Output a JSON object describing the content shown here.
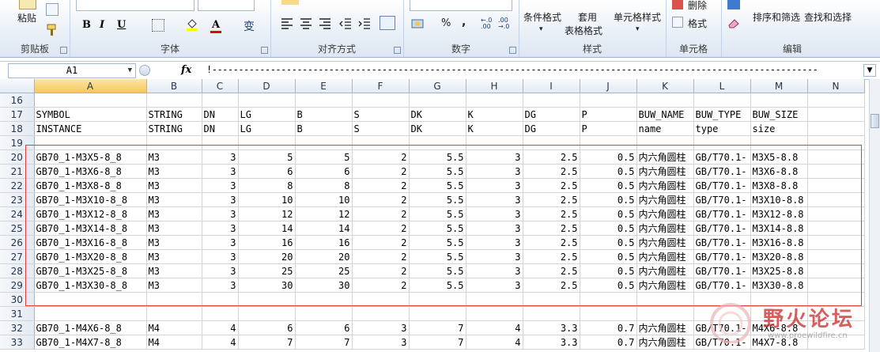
{
  "ribbon": {
    "clipboard": {
      "label": "剪贴板",
      "paste": "粘贴"
    },
    "font": {
      "label": "字体",
      "bold": "B",
      "italic": "I",
      "underline": "U",
      "font_color_glyph": "A",
      "phonetic_glyph": "变"
    },
    "alignment": {
      "label": "对齐方式"
    },
    "number": {
      "label": "数字",
      "percent": "%",
      "comma": ","
    },
    "styles": {
      "label": "样式",
      "conditional": "条件格式",
      "table_line1": "套用",
      "table_line2": "表格格式",
      "cell_styles": "单元格样式"
    },
    "cells": {
      "label": "单元格",
      "delete": "删除",
      "format": "格式"
    },
    "editing": {
      "label": "编辑",
      "sort_filter": "排序和筛选",
      "find_select": "查找和选择"
    }
  },
  "formula_bar": {
    "name_box": "A1",
    "fx": "fx",
    "content": "!------------------------------------------------------------------------------------------------------------------"
  },
  "columns": [
    "A",
    "B",
    "C",
    "D",
    "E",
    "F",
    "G",
    "H",
    "I",
    "J",
    "K",
    "L",
    "M",
    "N"
  ],
  "rows": [
    {
      "n": "16",
      "cells": [
        "",
        "",
        "",
        "",
        "",
        "",
        "",
        "",
        "",
        "",
        "",
        "",
        "",
        ""
      ]
    },
    {
      "n": "17",
      "cells": [
        "SYMBOL",
        "STRING",
        "DN",
        "LG",
        "B",
        "S",
        "DK",
        "K",
        "DG",
        "P",
        "BUW_NAME",
        "BUW_TYPE",
        "BUW_SIZE",
        ""
      ]
    },
    {
      "n": "18",
      "cells": [
        "INSTANCE",
        "STRING",
        "DN",
        "LG",
        "B",
        "S",
        "DK",
        "K",
        "DG",
        "P",
        "name",
        "type",
        "size",
        ""
      ]
    },
    {
      "n": "19",
      "cells": [
        "",
        "",
        "",
        "",
        "",
        "",
        "",
        "",
        "",
        "",
        "",
        "",
        "",
        ""
      ]
    },
    {
      "n": "20",
      "cells": [
        "GB70_1-M3X5-8_8",
        "M3",
        "3",
        "5",
        "5",
        "2",
        "5.5",
        "3",
        "2.5",
        "0.5",
        "内六角圆柱",
        "GB/T70.1-",
        "M3X5-8.8",
        ""
      ]
    },
    {
      "n": "21",
      "cells": [
        "GB70_1-M3X6-8_8",
        "M3",
        "3",
        "6",
        "6",
        "2",
        "5.5",
        "3",
        "2.5",
        "0.5",
        "内六角圆柱",
        "GB/T70.1-",
        "M3X6-8.8",
        ""
      ]
    },
    {
      "n": "22",
      "cells": [
        "GB70_1-M3X8-8_8",
        "M3",
        "3",
        "8",
        "8",
        "2",
        "5.5",
        "3",
        "2.5",
        "0.5",
        "内六角圆柱",
        "GB/T70.1-",
        "M3X8-8.8",
        ""
      ]
    },
    {
      "n": "23",
      "cells": [
        "GB70_1-M3X10-8_8",
        "M3",
        "3",
        "10",
        "10",
        "2",
        "5.5",
        "3",
        "2.5",
        "0.5",
        "内六角圆柱",
        "GB/T70.1-",
        "M3X10-8.8",
        ""
      ]
    },
    {
      "n": "24",
      "cells": [
        "GB70_1-M3X12-8_8",
        "M3",
        "3",
        "12",
        "12",
        "2",
        "5.5",
        "3",
        "2.5",
        "0.5",
        "内六角圆柱",
        "GB/T70.1-",
        "M3X12-8.8",
        ""
      ]
    },
    {
      "n": "25",
      "cells": [
        "GB70_1-M3X14-8_8",
        "M3",
        "3",
        "14",
        "14",
        "2",
        "5.5",
        "3",
        "2.5",
        "0.5",
        "内六角圆柱",
        "GB/T70.1-",
        "M3X14-8.8",
        ""
      ]
    },
    {
      "n": "26",
      "cells": [
        "GB70_1-M3X16-8_8",
        "M3",
        "3",
        "16",
        "16",
        "2",
        "5.5",
        "3",
        "2.5",
        "0.5",
        "内六角圆柱",
        "GB/T70.1-",
        "M3X16-8.8",
        ""
      ]
    },
    {
      "n": "27",
      "cells": [
        "GB70_1-M3X20-8_8",
        "M3",
        "3",
        "20",
        "20",
        "2",
        "5.5",
        "3",
        "2.5",
        "0.5",
        "内六角圆柱",
        "GB/T70.1-",
        "M3X20-8.8",
        ""
      ]
    },
    {
      "n": "28",
      "cells": [
        "GB70_1-M3X25-8_8",
        "M3",
        "3",
        "25",
        "25",
        "2",
        "5.5",
        "3",
        "2.5",
        "0.5",
        "内六角圆柱",
        "GB/T70.1-",
        "M3X25-8.8",
        ""
      ]
    },
    {
      "n": "29",
      "cells": [
        "GB70_1-M3X30-8_8",
        "M3",
        "3",
        "30",
        "30",
        "2",
        "5.5",
        "3",
        "2.5",
        "0.5",
        "内六角圆柱",
        "GB/T70.1-",
        "M3X30-8.8",
        ""
      ]
    },
    {
      "n": "30",
      "cells": [
        "",
        "",
        "",
        "",
        "",
        "",
        "",
        "",
        "",
        "",
        "",
        "",
        "",
        ""
      ]
    },
    {
      "n": "31",
      "cells": [
        "",
        "",
        "",
        "",
        "",
        "",
        "",
        "",
        "",
        "",
        "",
        "",
        "",
        ""
      ]
    },
    {
      "n": "32",
      "cells": [
        "GB70_1-M4X6-8_8",
        "M4",
        "4",
        "6",
        "6",
        "3",
        "7",
        "4",
        "3.3",
        "0.7",
        "内六角圆柱",
        "GB/T70.1-",
        "M4X6-8.8",
        ""
      ]
    },
    {
      "n": "33",
      "cells": [
        "GB70_1-M4X7-8_8",
        "M4",
        "4",
        "7",
        "7",
        "3",
        "7",
        "4",
        "3.3",
        "0.7",
        "内六角圆柱",
        "GB/T70.1-",
        "M4X7-8.8",
        ""
      ]
    }
  ],
  "numeric_columns": [
    2,
    3,
    4,
    5,
    6,
    7,
    8,
    9
  ],
  "selected_column": "A",
  "watermark": {
    "brand": "野火论坛",
    "url": "www.proewildfire.cn"
  },
  "colors": {
    "highlight_box": "#e63a3a",
    "selected_header": "#f6c85e"
  }
}
